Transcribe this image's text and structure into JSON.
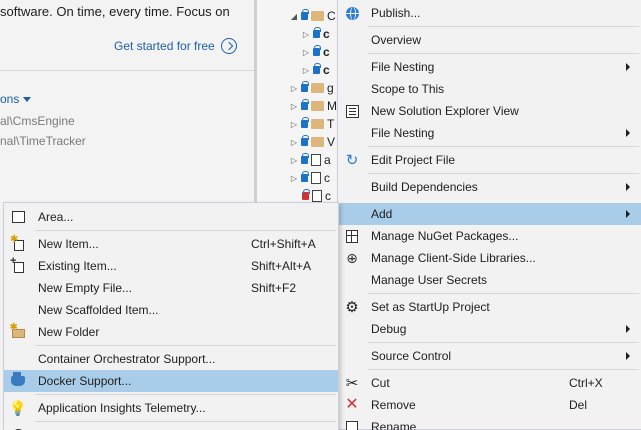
{
  "start_page": {
    "promo_text": "software. On time, every time. Focus on",
    "get_started_link": "Get started for free",
    "options_link": "ons",
    "recent_paths": [
      "al\\CmsEngine",
      "nal\\TimeTracker"
    ]
  },
  "solution_tree": {
    "rows": [
      {
        "label": "C",
        "bold": false
      },
      {
        "label": "c",
        "bold": true
      },
      {
        "label": "c",
        "bold": true
      },
      {
        "label": "c",
        "bold": true
      },
      {
        "label": "g",
        "bold": false
      },
      {
        "label": "M",
        "bold": false
      },
      {
        "label": "T",
        "bold": false
      },
      {
        "label": "V",
        "bold": false
      },
      {
        "label": "a",
        "bold": false
      },
      {
        "label": "c",
        "bold": false
      },
      {
        "label": "c",
        "bold": false
      }
    ]
  },
  "context_menu": {
    "items": {
      "publish": "Publish...",
      "overview": "Overview",
      "file_nesting_1": "File Nesting",
      "scope_to_this": "Scope to This",
      "new_solution_explorer_view": "New Solution Explorer View",
      "file_nesting_2": "File Nesting",
      "edit_project_file": "Edit Project File",
      "build_dependencies": "Build Dependencies",
      "add": "Add",
      "manage_nuget": "Manage NuGet Packages...",
      "manage_client_libs": "Manage Client-Side Libraries...",
      "manage_user_secrets": "Manage User Secrets",
      "set_startup": "Set as StartUp Project",
      "debug": "Debug",
      "source_control": "Source Control",
      "cut": "Cut",
      "cut_shortcut": "Ctrl+X",
      "remove": "Remove",
      "remove_shortcut": "Del",
      "rename": "Rename"
    }
  },
  "add_submenu": {
    "items": {
      "area": "Area...",
      "new_item": "New Item...",
      "new_item_shortcut": "Ctrl+Shift+A",
      "existing_item": "Existing Item...",
      "existing_item_shortcut": "Shift+Alt+A",
      "new_empty_file": "New Empty File...",
      "new_empty_file_shortcut": "Shift+F2",
      "new_scaffolded_item": "New Scaffolded Item...",
      "new_folder": "New Folder",
      "container_orchestrator": "Container Orchestrator Support...",
      "docker_support": "Docker Support...",
      "app_insights": "Application Insights Telemetry..."
    }
  },
  "colors": {
    "highlight": "#a9cde8",
    "menu_bg": "#f2f2f2",
    "link": "#1c5fa8"
  }
}
